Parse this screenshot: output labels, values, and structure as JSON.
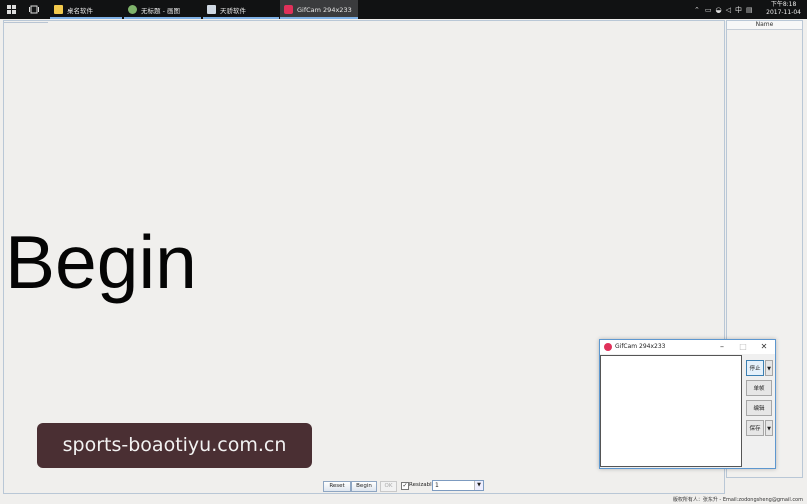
{
  "taskbar": {
    "tasks": [
      {
        "label": "桌名软件",
        "icon_color": "#f2c94c"
      },
      {
        "label": "无标题 - 画图",
        "icon_color": "#7fb36b"
      },
      {
        "label": "天骄软件",
        "icon_color": "#cfd8e3"
      },
      {
        "label": "GifCam 294x233",
        "icon_color": "#e0315a"
      }
    ],
    "clock_time": "下午8:18",
    "clock_date": "2017-11-04"
  },
  "main": {
    "big_text": "Begin"
  },
  "rightpanel": {
    "header": "Name"
  },
  "bottom": {
    "reset_label": "Reset",
    "begin_label": "Begin",
    "ok_label": "OK",
    "checkbox_label": "Resizable",
    "checkbox_checked": "✓",
    "combo_value": "1",
    "credit": "版权所有人：张东升 - Email:zodongsheng@gmail.com"
  },
  "gifcam": {
    "title": "GifCam 294x233",
    "buttons": {
      "stop": "停止",
      "frame": "单帧",
      "edit": "编辑",
      "save": "保存"
    }
  },
  "watermark": {
    "text": "sports-boaotiyu.com.cn"
  },
  "colors": {
    "taskbar_bg": "#111213",
    "accent": "#5d97cf",
    "gifcam_logo": "#e0315a"
  }
}
